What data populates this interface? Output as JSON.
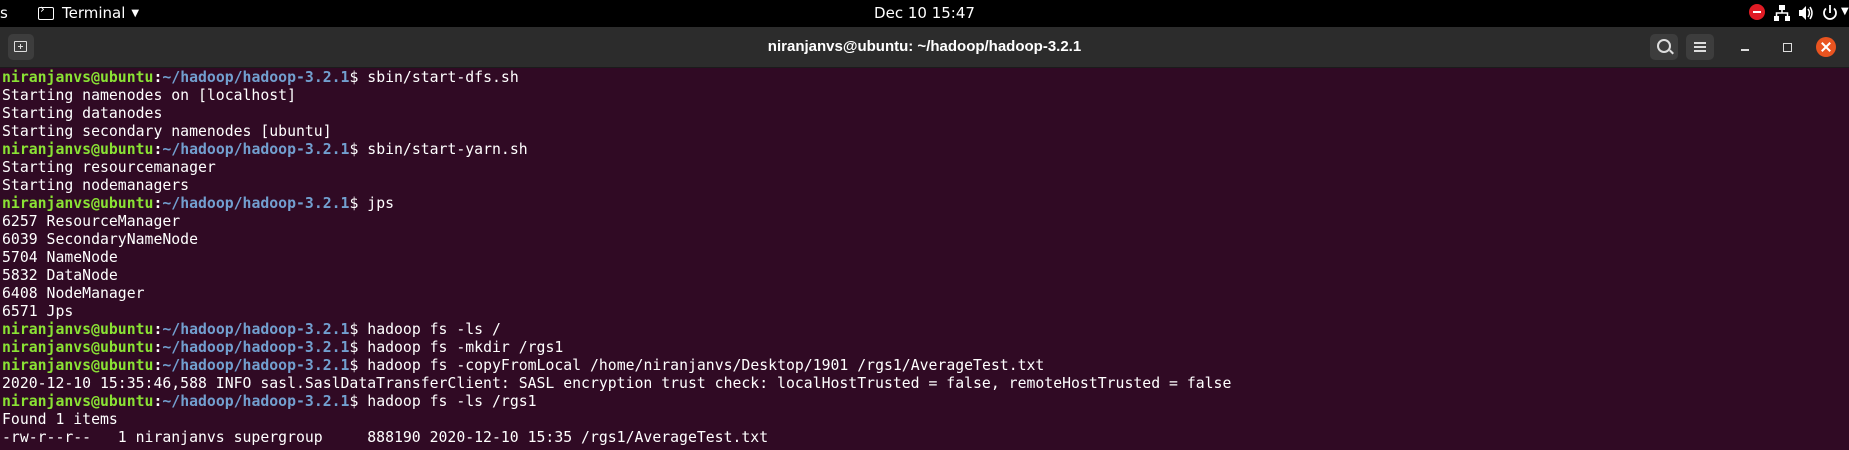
{
  "topbar": {
    "activities_partial": "s",
    "app_menu_label": "Terminal",
    "clock": "Dec 10  15:47"
  },
  "window": {
    "title": "niranjanvs@ubuntu: ~/hadoop/hadoop-3.2.1"
  },
  "prompt": {
    "user_host": "niranjanvs@ubuntu",
    "separator": ":",
    "path": "~/hadoop/hadoop-3.2.1",
    "symbol": "$ "
  },
  "terminal": {
    "lines": [
      {
        "type": "prompt",
        "text": "sbin/start-dfs.sh"
      },
      {
        "type": "output",
        "text": "Starting namenodes on [localhost]"
      },
      {
        "type": "output",
        "text": "Starting datanodes"
      },
      {
        "type": "output",
        "text": "Starting secondary namenodes [ubuntu]"
      },
      {
        "type": "prompt",
        "text": "sbin/start-yarn.sh"
      },
      {
        "type": "output",
        "text": "Starting resourcemanager"
      },
      {
        "type": "output",
        "text": "Starting nodemanagers"
      },
      {
        "type": "prompt",
        "text": "jps"
      },
      {
        "type": "output",
        "text": "6257 ResourceManager"
      },
      {
        "type": "output",
        "text": "6039 SecondaryNameNode"
      },
      {
        "type": "output",
        "text": "5704 NameNode"
      },
      {
        "type": "output",
        "text": "5832 DataNode"
      },
      {
        "type": "output",
        "text": "6408 NodeManager"
      },
      {
        "type": "output",
        "text": "6571 Jps"
      },
      {
        "type": "prompt",
        "text": "hadoop fs -ls /"
      },
      {
        "type": "prompt",
        "text": "hadoop fs -mkdir /rgs1"
      },
      {
        "type": "prompt",
        "text": "hadoop fs -copyFromLocal /home/niranjanvs/Desktop/1901 /rgs1/AverageTest.txt"
      },
      {
        "type": "output",
        "text": "2020-12-10 15:35:46,588 INFO sasl.SaslDataTransferClient: SASL encryption trust check: localHostTrusted = false, remoteHostTrusted = false"
      },
      {
        "type": "prompt",
        "text": "hadoop fs -ls /rgs1"
      },
      {
        "type": "output",
        "text": "Found 1 items"
      },
      {
        "type": "output",
        "text": "-rw-r--r--   1 niranjanvs supergroup     888190 2020-12-10 15:35 /rgs1/AverageTest.txt"
      }
    ]
  },
  "colors": {
    "terminal_bg": "#300a24",
    "prompt_user": "#8ae234",
    "prompt_path": "#729fcf",
    "close_button": "#e95420",
    "dnd_indicator": "#e01b24"
  },
  "icons": {
    "app_menu": "terminal-icon",
    "new_tab": "new-tab-icon",
    "search": "search-icon",
    "menu": "hamburger-menu-icon",
    "network": "network-icon",
    "volume": "speaker-icon",
    "power": "power-icon",
    "do_not_disturb": "do-not-disturb-icon"
  }
}
